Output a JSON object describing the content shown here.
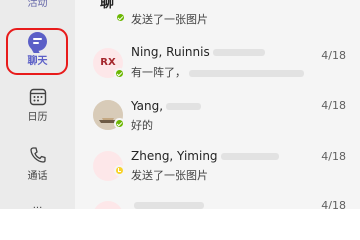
{
  "rail": {
    "activity_label": "活动",
    "chat_label": "聊天",
    "calendar_label": "日历",
    "calls_label": "通话",
    "more_label": "..."
  },
  "list": {
    "header": "聊",
    "rows": [
      {
        "name": "",
        "preview": "发送了一张图片",
        "date": "",
        "avatar": "",
        "status": "available"
      },
      {
        "name": "Ning, Ruinnis",
        "preview": "有一阵了，",
        "date": "4/18",
        "avatar": "RX",
        "status": "available"
      },
      {
        "name": "Yang,",
        "preview": "好的",
        "date": "4/18",
        "avatar": "",
        "status": "available"
      },
      {
        "name": "Zheng, Yiming",
        "preview": "发送了一张图片",
        "date": "4/18",
        "avatar": "",
        "status": "away"
      },
      {
        "name": "",
        "preview": "",
        "date": "4/18",
        "avatar": "",
        "status": "available"
      }
    ]
  },
  "colors": {
    "accent": "#5b5fc7",
    "focus_ring": "#e81b1b",
    "status_available": "#6bb700",
    "status_away": "#f8d22a"
  }
}
